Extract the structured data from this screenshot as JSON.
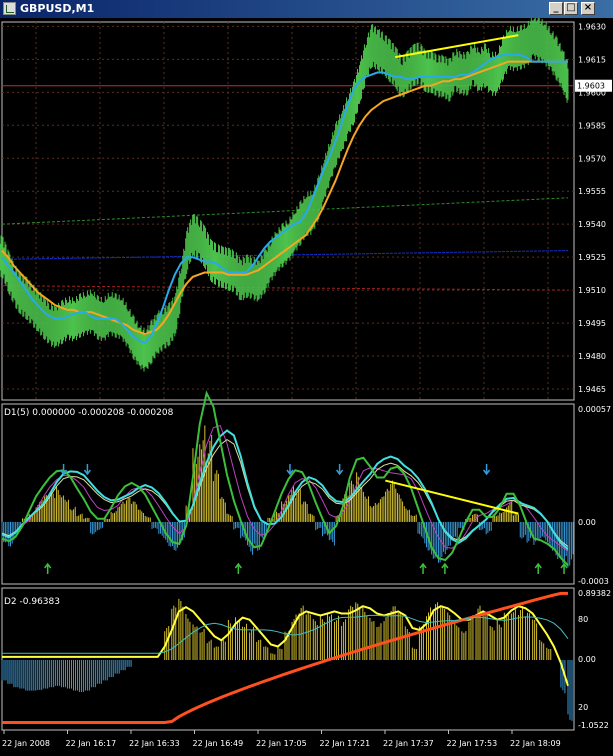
{
  "window": {
    "title": "GBPUSD,M1",
    "buttons": {
      "minimize": "_",
      "maximize": "□",
      "close": "×"
    }
  },
  "colors": {
    "background": "#000000",
    "grid": "#5a3020",
    "frame": "#c0c0c0",
    "price": "#4cc24c",
    "ma_fast": "#2aa9e8",
    "ma_slow": "#f5a623",
    "ma_green": "#2e8b2e",
    "ma_blue": "#1530c8",
    "ma_red": "#a02020",
    "trend": "#ffff00",
    "histo_yellow": "#d4c030",
    "histo_blue": "#3a9ad9",
    "current_price_line": "#c03030"
  },
  "chart_data": [
    {
      "type": "line",
      "panel": "main",
      "title": "GBPUSD,M1",
      "ylim": [
        1.946,
        1.9632
      ],
      "y_ticks": [
        "1.9630",
        "1.9615",
        "1.9600",
        "1.9585",
        "1.9570",
        "1.9555",
        "1.9540",
        "1.9525",
        "1.9510",
        "1.9495",
        "1.9480",
        "1.9465"
      ],
      "current_price_label": "1.9603",
      "current_price": 1.9603,
      "x": [
        0,
        6,
        12,
        18,
        24,
        30,
        36,
        42,
        48,
        54,
        60,
        66,
        72,
        78,
        84,
        90,
        96,
        102,
        108,
        114,
        120,
        126,
        132,
        138,
        144,
        150,
        156,
        162,
        168,
        174,
        180,
        186,
        192,
        198,
        204,
        210,
        216,
        222,
        228,
        234,
        240,
        246,
        252,
        258,
        264,
        270,
        276,
        282,
        288,
        294,
        300,
        306,
        312,
        318,
        324,
        330,
        336,
        342,
        348,
        354,
        360,
        366,
        372,
        378,
        384,
        390,
        396,
        402,
        408,
        414,
        420,
        426,
        432,
        438,
        444,
        450,
        456,
        462,
        468,
        474,
        480,
        486,
        492,
        498,
        504,
        510,
        516,
        522,
        528,
        534,
        540,
        546,
        552,
        558,
        564,
        570
      ],
      "series": [
        {
          "role": "price",
          "values": [
            1.9525,
            1.9518,
            1.9512,
            1.9508,
            1.9506,
            1.9503,
            1.95,
            1.9497,
            1.9494,
            1.9493,
            1.9495,
            1.9497,
            1.9496,
            1.9498,
            1.9499,
            1.95,
            1.9497,
            1.9496,
            1.9499,
            1.9498,
            1.9497,
            1.9493,
            1.9488,
            1.9484,
            1.9482,
            1.9486,
            1.949,
            1.9492,
            1.9494,
            1.9498,
            1.9512,
            1.9528,
            1.9535,
            1.9533,
            1.9529,
            1.9523,
            1.9521,
            1.952,
            1.9519,
            1.9518,
            1.9514,
            1.9516,
            1.9515,
            1.9514,
            1.9518,
            1.9523,
            1.9527,
            1.953,
            1.9532,
            1.9536,
            1.954,
            1.9544,
            1.9545,
            1.9551,
            1.956,
            1.9568,
            1.9576,
            1.9582,
            1.9589,
            1.9595,
            1.9604,
            1.9614,
            1.9621,
            1.9619,
            1.9617,
            1.9614,
            1.9611,
            1.9606,
            1.9609,
            1.9612,
            1.9613,
            1.9609,
            1.9609,
            1.9607,
            1.9607,
            1.9605,
            1.961,
            1.9608,
            1.9608,
            1.9613,
            1.9609,
            1.9612,
            1.9608,
            1.9608,
            1.9615,
            1.962,
            1.9619,
            1.962,
            1.9621,
            1.9625,
            1.9624,
            1.9622,
            1.9619,
            1.9615,
            1.961,
            1.9603
          ]
        },
        {
          "role": "ma_fast",
          "values": [
            1.9525,
            1.9521,
            1.9518,
            1.9514,
            1.951,
            1.9506,
            1.9503,
            1.95,
            1.9498,
            1.9497,
            1.9497,
            1.9498,
            1.9499,
            1.95,
            1.95,
            1.9498,
            1.9497,
            1.9497,
            1.9497,
            1.9497,
            1.9495,
            1.9492,
            1.9489,
            1.9487,
            1.9486,
            1.9489,
            1.9495,
            1.9502,
            1.951,
            1.9517,
            1.9522,
            1.9525,
            1.9525,
            1.9524,
            1.9523,
            1.9523,
            1.9522,
            1.952,
            1.9518,
            1.9518,
            1.9518,
            1.9518,
            1.9521,
            1.9525,
            1.9529,
            1.9532,
            1.9534,
            1.9536,
            1.9538,
            1.954,
            1.9541,
            1.9545,
            1.9551,
            1.9558,
            1.9565,
            1.9571,
            1.9578,
            1.9586,
            1.9594,
            1.9601,
            1.9605,
            1.9607,
            1.9608,
            1.9609,
            1.9609,
            1.9608,
            1.9607,
            1.9607,
            1.9606,
            1.9606,
            1.9607,
            1.9607,
            1.9607,
            1.9607,
            1.9607,
            1.9607,
            1.9607,
            1.9608,
            1.9608,
            1.9609,
            1.9611,
            1.9613,
            1.9615,
            1.9616,
            1.9617,
            1.9617,
            1.9617,
            1.9617,
            1.9616,
            1.9614,
            1.9614,
            1.9614,
            1.9614,
            1.9614,
            1.9614,
            1.9614
          ]
        },
        {
          "role": "ma_slow",
          "values": [
            1.9528,
            1.9525,
            1.9521,
            1.9518,
            1.9515,
            1.9512,
            1.9509,
            1.9507,
            1.9505,
            1.9503,
            1.9502,
            1.9501,
            1.9501,
            1.95,
            1.95,
            1.95,
            1.9499,
            1.9498,
            1.9497,
            1.9496,
            1.9495,
            1.9494,
            1.9492,
            1.9491,
            1.949,
            1.9491,
            1.9492,
            1.9495,
            1.9499,
            1.9504,
            1.9509,
            1.9513,
            1.9516,
            1.9517,
            1.9518,
            1.9518,
            1.9518,
            1.9518,
            1.9517,
            1.9517,
            1.9517,
            1.9517,
            1.9518,
            1.9519,
            1.9521,
            1.9523,
            1.9525,
            1.9527,
            1.9529,
            1.9531,
            1.9533,
            1.9535,
            1.9539,
            1.9543,
            1.9548,
            1.9554,
            1.956,
            1.9567,
            1.9574,
            1.958,
            1.9585,
            1.9589,
            1.9592,
            1.9594,
            1.9596,
            1.9597,
            1.9598,
            1.9599,
            1.96,
            1.9601,
            1.9602,
            1.9603,
            1.9603,
            1.9604,
            1.9605,
            1.9605,
            1.9606,
            1.9606,
            1.9607,
            1.9608,
            1.9609,
            1.961,
            1.9611,
            1.9612,
            1.9613,
            1.9614,
            1.9614,
            1.9614,
            1.9614,
            1.9614,
            1.9614,
            1.9614,
            1.9614,
            1.9614,
            1.9614,
            1.9614
          ]
        },
        {
          "role": "ma_green_dashed",
          "values": [
            1.954,
            1.9552
          ]
        },
        {
          "role": "ma_blue",
          "values": [
            1.9524,
            1.9528
          ]
        },
        {
          "role": "ma_red",
          "values": [
            1.9512,
            1.951
          ]
        }
      ],
      "trendline": {
        "x": [
          396,
          520
        ],
        "y": [
          1.9616,
          1.9626
        ]
      }
    },
    {
      "type": "bar",
      "panel": "indicator_1",
      "label": "D1(5) 0.000000 -0.000208 -0.000208",
      "ylim": [
        -0.0003,
        0.00057
      ],
      "y_ticks": [
        "0.00057",
        "0.00",
        "-0.0003"
      ],
      "histogram": [
        -0.0001,
        -0.00012,
        -6e-05,
        2e-05,
        5e-05,
        0.0001,
        0.00013,
        0.00015,
        0.00017,
        0.00014,
        8e-05,
        4e-05,
        2e-05,
        -6e-05,
        -4e-05,
        2e-05,
        6e-05,
        0.0001,
        0.00012,
        0.0001,
        6e-05,
        3e-05,
        -4e-05,
        -8e-05,
        -0.00012,
        -0.00014,
        -0.0001,
        8e-05,
        0.0004,
        0.0005,
        0.00042,
        0.00025,
        0.00012,
        4e-05,
        -4e-05,
        -0.0001,
        -0.00016,
        -0.00014,
        -8e-05,
        2e-05,
        6e-05,
        0.00012,
        0.00018,
        0.00016,
        0.0001,
        4e-05,
        -4e-05,
        -8e-05,
        -0.00012,
        4e-05,
        0.00014,
        0.0002,
        0.00024,
        0.00016,
        0.0001,
        0.00012,
        0.00016,
        0.0002,
        0.00014,
        8e-05,
        4e-05,
        -8e-05,
        -0.00014,
        -0.00018,
        -0.0002,
        -0.00016,
        -0.0001,
        -4e-05,
        2e-05,
        4e-05,
        -4e-05,
        -6e-05,
        4e-05,
        6e-05,
        0.0001,
        4e-05,
        -8e-05,
        -0.0001,
        -0.00012,
        -0.0001,
        -0.00014,
        -0.00018,
        -0.0002,
        -0.00022
      ],
      "trendline": {
        "x": [
          386,
          520
        ],
        "y": [
          0.0002,
          4e-05
        ]
      },
      "arrows_down_x": [
        62,
        86,
        290,
        340,
        488
      ],
      "arrows_up_x": [
        46,
        238,
        424,
        446,
        540,
        566
      ]
    },
    {
      "type": "bar",
      "panel": "indicator_2",
      "label": "D2 -0.96383",
      "ylim": [
        -1.0522,
        0.8938
      ],
      "y_ticks": [
        "0.89382",
        "80",
        "0.00",
        "20",
        "-1.0522"
      ],
      "histogram_pos": [
        0,
        0,
        0,
        0,
        0,
        0,
        0,
        0,
        0,
        0,
        0,
        0,
        0,
        0,
        0,
        0,
        0,
        0,
        0,
        0,
        0,
        0,
        0,
        0.5,
        0.8,
        0.9,
        0.7,
        0.6,
        0.5,
        0.3,
        0.2,
        0.3,
        0.6,
        0.7,
        0.6,
        0.5,
        0.3,
        0.2,
        0.1,
        0.2,
        0.5,
        0.7,
        0.8,
        0.7,
        0.6,
        0.7,
        0.8,
        0.7,
        0.6,
        0.8,
        0.85,
        0.8,
        0.7,
        0.6,
        0.7,
        0.8,
        0.7,
        0.5,
        0.2,
        0.6,
        0.8,
        0.85,
        0.8,
        0.7,
        0.6,
        0.5,
        0.7,
        0.8,
        0.7,
        0.5,
        0.6,
        0.8,
        0.85,
        0.8,
        0.7,
        0.6,
        0.3,
        0.2,
        0.0,
        -0.5,
        -0.9
      ],
      "histogram_neg_front": [
        -0.3,
        -0.35,
        -0.4,
        -0.42,
        -0.45,
        -0.45,
        -0.44,
        -0.42,
        -0.4,
        -0.38,
        -0.4,
        -0.42,
        -0.45,
        -0.47,
        -0.45,
        -0.4,
        -0.35,
        -0.3,
        -0.25,
        -0.2,
        -0.15,
        -0.1
      ]
    }
  ],
  "x_axis": {
    "labels": [
      "22 Jan 2008",
      "22 Jan 16:17",
      "22 Jan 16:33",
      "22 Jan 16:49",
      "22 Jan 17:05",
      "22 Jan 17:21",
      "22 Jan 17:37",
      "22 Jan 17:53",
      "22 Jan 18:09"
    ]
  }
}
